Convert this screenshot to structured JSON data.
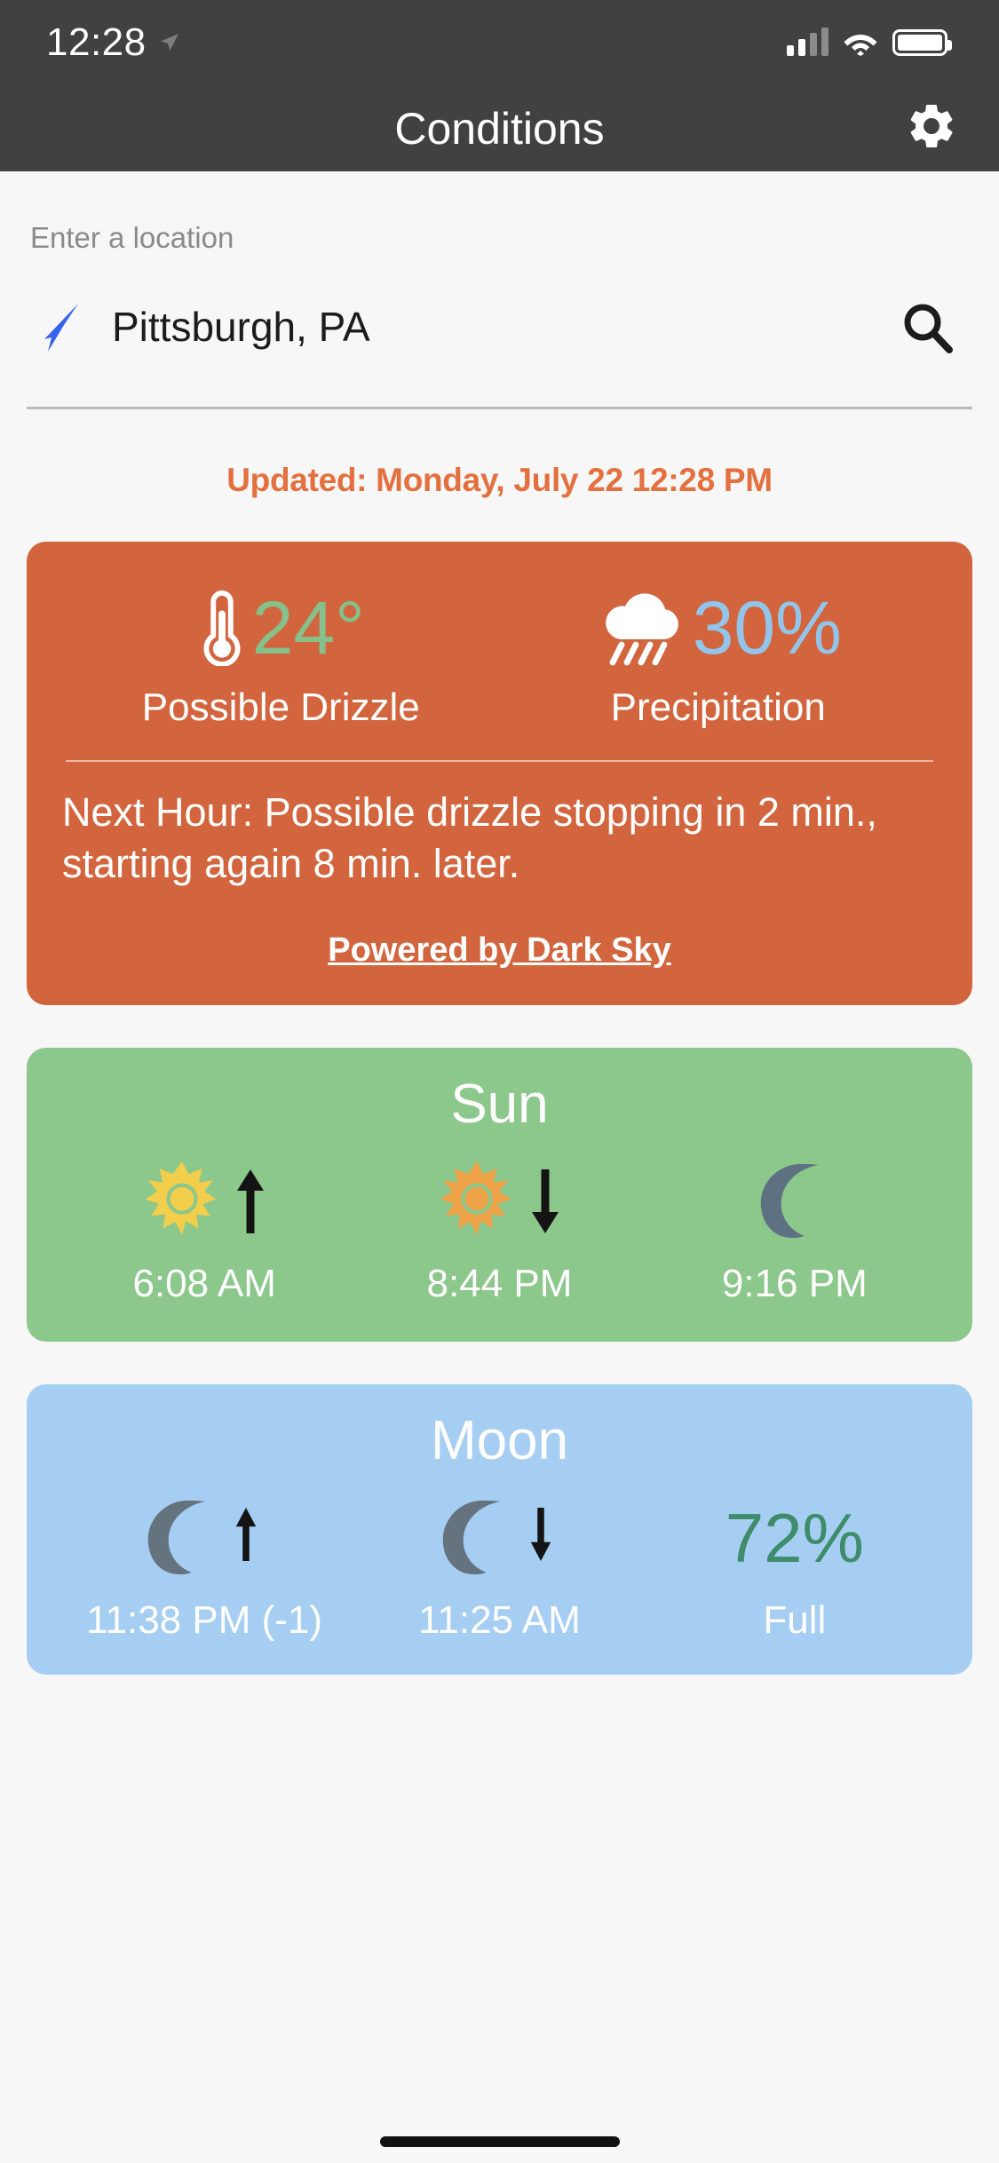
{
  "status_bar": {
    "time": "12:28",
    "location_arrow_icon": "location-arrow-icon",
    "cellular_icon": "cellular-signal-icon",
    "wifi_icon": "wifi-icon",
    "battery_icon": "battery-icon"
  },
  "app_bar": {
    "title": "Conditions",
    "settings_icon": "gear-icon"
  },
  "search": {
    "label": "Enter a location",
    "value": "Pittsburgh, PA",
    "placeholder": "Enter a location",
    "current_location_icon": "navigation-arrow-icon",
    "search_icon": "search-icon"
  },
  "updated": {
    "text": "Updated: Monday, July 22 12:28 PM",
    "color": "#E4703F"
  },
  "conditions_card": {
    "background": "#D2653E",
    "temperature": {
      "icon": "thermometer-icon",
      "value": "24°",
      "color": "#86C08B",
      "caption": "Possible Drizzle"
    },
    "precipitation": {
      "icon": "rain-cloud-icon",
      "value": "30%",
      "color": "#93C4EA",
      "caption": "Precipitation"
    },
    "next_hour": "Next Hour: Possible drizzle stopping in 2 min., starting again 8 min. later.",
    "attribution": "Powered by Dark Sky"
  },
  "sun_card": {
    "background": "#8CC78C",
    "title": "Sun",
    "items": [
      {
        "icon": "sunrise-icon",
        "arrow": "arrow-up-icon",
        "time": "6:08 AM"
      },
      {
        "icon": "sunset-icon",
        "arrow": "arrow-down-icon",
        "time": "8:44 PM"
      },
      {
        "icon": "moon-icon",
        "arrow": "",
        "time": "9:16 PM"
      }
    ]
  },
  "moon_card": {
    "background": "#A6CEF2",
    "title": "Moon",
    "items": [
      {
        "icon": "moonrise-icon",
        "arrow": "arrow-up-icon",
        "time": "11:38 PM (-1)"
      },
      {
        "icon": "moonset-icon",
        "arrow": "arrow-down-icon",
        "time": "11:25 AM"
      }
    ],
    "illumination": {
      "value": "72%",
      "color": "#3E8C6B",
      "label": "Full"
    }
  }
}
